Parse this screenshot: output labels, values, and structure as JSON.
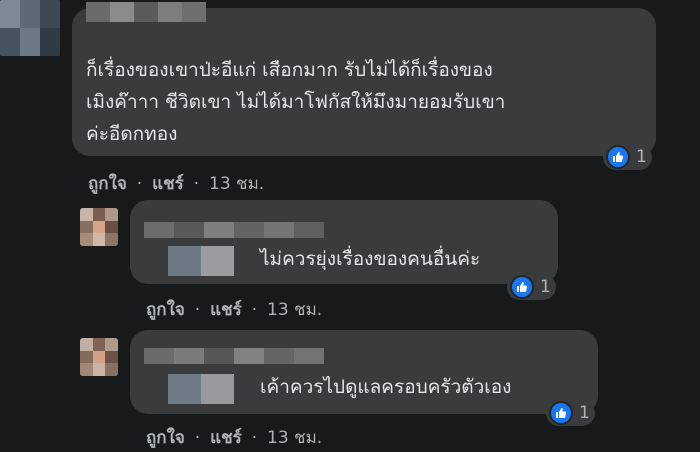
{
  "comments": [
    {
      "text_lines": [
        "ก็เรื่องของเขาป่ะอีแก่ เสือกมาก รับไม่ได้ก็เรื่องของ",
        "เมิงค๊าาา ชีวิตเขา ไม่ได้มาโฟกัสให้มึงมายอมรับเขา",
        "ค่ะอีดกทอง"
      ],
      "like_label": "ถูกใจ",
      "share_label": "แชร์",
      "time": "13 ชม.",
      "reaction_count": "1"
    },
    {
      "text": "ไม่ควรยุ่งเรื่องของคนอื่นค่ะ",
      "like_label": "ถูกใจ",
      "share_label": "แชร์",
      "time": "13 ชม.",
      "reaction_count": "1"
    },
    {
      "text": "เค้าควรไปดูแลครอบครัวตัวเอง",
      "like_label": "ถูกใจ",
      "share_label": "แชร์",
      "time": "13 ชม.",
      "reaction_count": "1"
    }
  ],
  "separator": "·",
  "icons": {
    "reaction": "like-thumb-icon",
    "avatar": "avatar"
  },
  "colors": {
    "background": "#18191a",
    "bubble": "#3a3b3c",
    "like_blue": "#1877f2",
    "meta_text": "#b0b3b8"
  }
}
